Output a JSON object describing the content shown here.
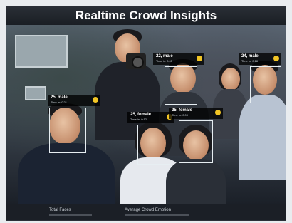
{
  "header": {
    "title": "Realtime Crowd Insights"
  },
  "faces": [
    {
      "label": "25, male",
      "sub": "Time in: 0:21",
      "emotion": "happy-face-icon"
    },
    {
      "label": "22, male",
      "sub": "Time in: 0:05",
      "emotion": "happy-face-icon"
    },
    {
      "label": "24, male",
      "sub": "Time in: 0:18",
      "emotion": "happy-face-icon"
    },
    {
      "label": "25, female",
      "sub": "Time in: 0:12",
      "emotion": "happy-face-icon"
    },
    {
      "label": "25, female",
      "sub": "Time in: 0:09",
      "emotion": "happy-face-icon"
    }
  ],
  "footer": {
    "total_faces_label": "Total Faces",
    "average_emotion_label": "Average Crowd Emotion"
  },
  "colors": {
    "accent": "#f2c525",
    "panel": "#0f1319"
  }
}
